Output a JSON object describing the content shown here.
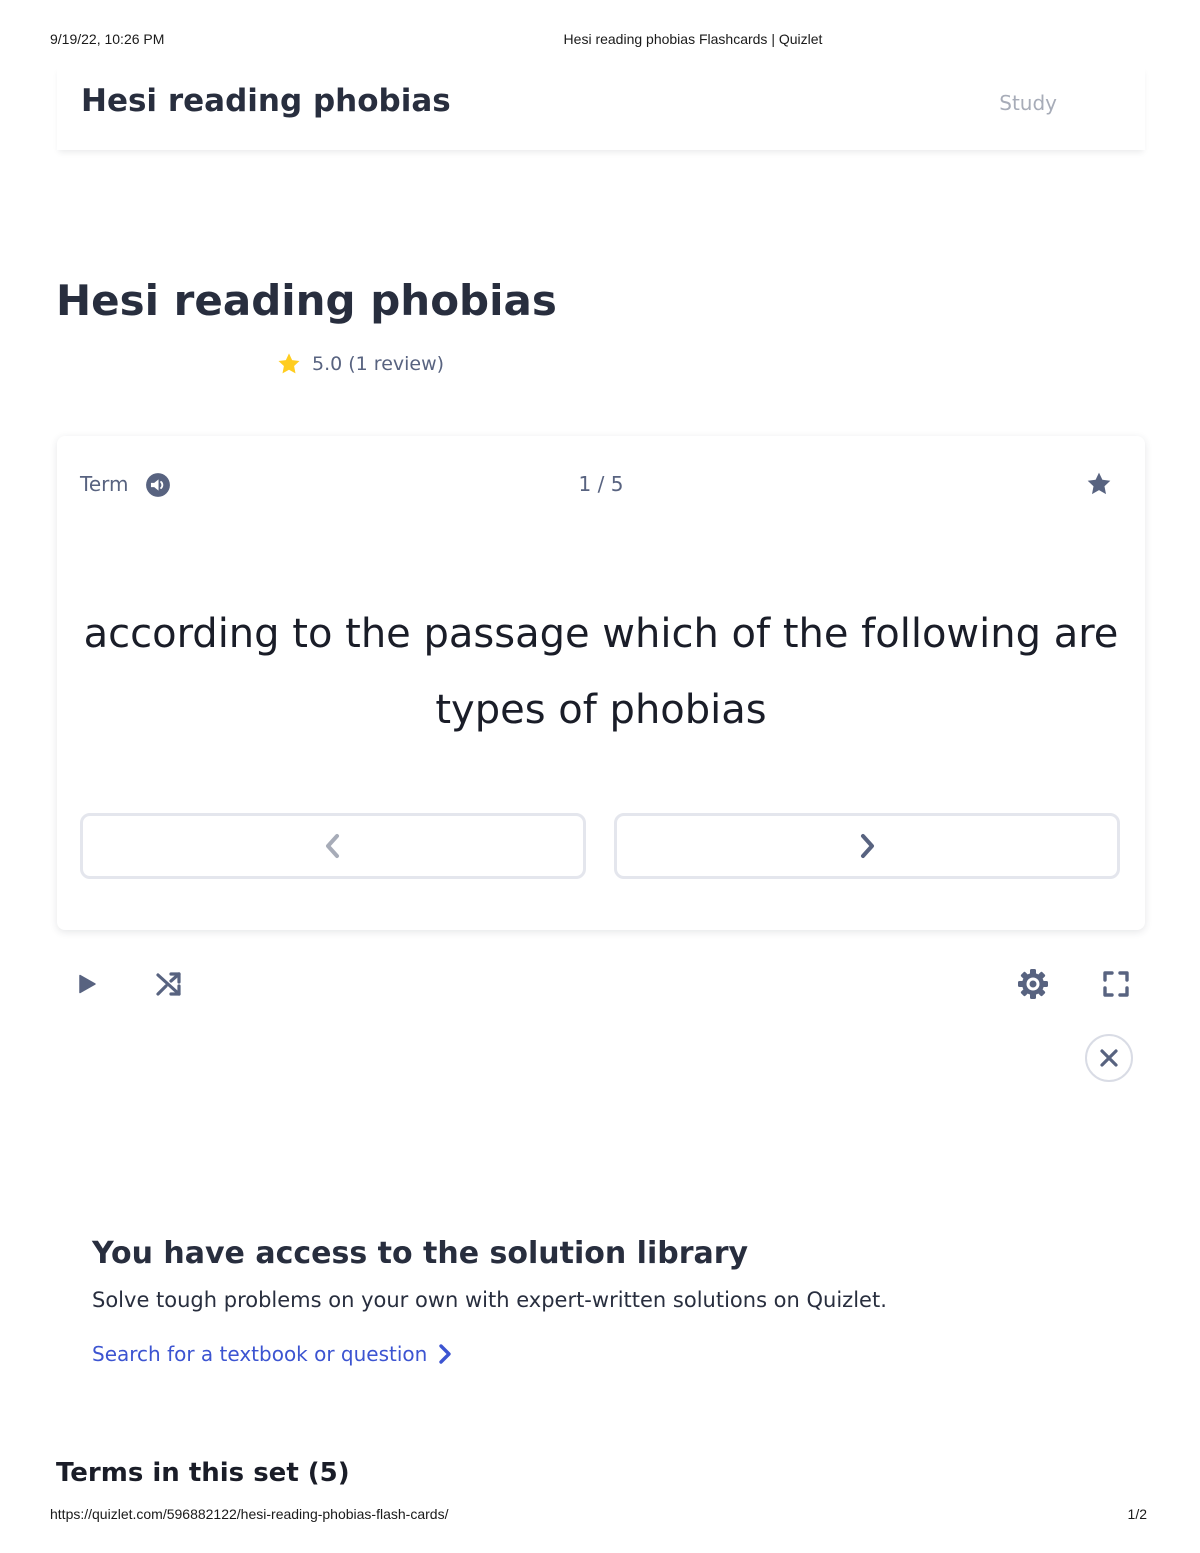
{
  "print_header": {
    "datetime": "9/19/22, 10:26 PM",
    "page_title": "Hesi reading phobias Flashcards | Quizlet"
  },
  "print_footer": {
    "url": "https://quizlet.com/596882122/hesi-reading-phobias-flash-cards/",
    "page": "1/2"
  },
  "header": {
    "title": "Hesi reading phobias",
    "study_label": "Study"
  },
  "set": {
    "title": "Hesi reading phobias",
    "rating_text": "5.0 (1 review)",
    "rating_icon": "star-icon",
    "rating_color": "#ffcd1f"
  },
  "card": {
    "side_label": "Term",
    "progress": "1 / 5",
    "current_index": 1,
    "total": 5,
    "term": "according to the passage which of the following are types of phobias",
    "audio_icon": "audio-icon",
    "star_icon": "star-icon",
    "prev_icon": "chevron-left-icon",
    "next_icon": "chevron-right-icon"
  },
  "controls": {
    "play_icon": "play-icon",
    "shuffle_icon": "shuffle-icon",
    "settings_icon": "gear-icon",
    "fullscreen_icon": "fullscreen-icon",
    "close_icon": "close-icon"
  },
  "solution_library": {
    "title": "You have access to the solution library",
    "description": "Solve tough problems on your own with expert-written solutions on Quizlet.",
    "link_text": "Search for a textbook or question",
    "link_color": "#3c54d1"
  },
  "terms_section": {
    "heading": "Terms in this set (5)"
  },
  "colors": {
    "text_primary": "#282e3e",
    "text_secondary": "#586380",
    "text_muted": "#a7acb8",
    "icon_color": "#586380",
    "border": "#e4e6ed"
  }
}
